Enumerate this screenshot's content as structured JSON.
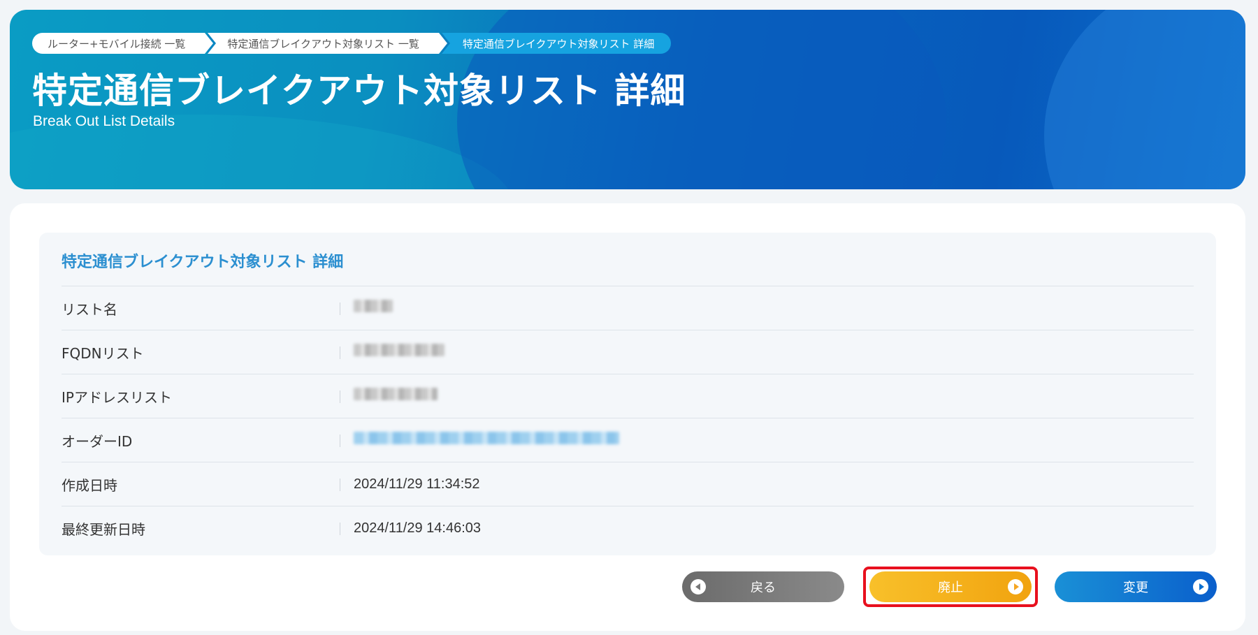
{
  "breadcrumb": {
    "items": [
      "ルーター+モバイル接続 一覧",
      "特定通信ブレイクアウト対象リスト 一覧",
      "特定通信ブレイクアウト対象リスト 詳細"
    ]
  },
  "header": {
    "title": "特定通信ブレイクアウト対象リスト 詳細",
    "subtitle": "Break Out List Details"
  },
  "detail": {
    "title": "特定通信ブレイクアウト対象リスト 詳細",
    "rows": [
      {
        "label": "リスト名",
        "value": "",
        "redacted": true
      },
      {
        "label": "FQDNリスト",
        "value": "",
        "redacted": true
      },
      {
        "label": "IPアドレスリスト",
        "value": "",
        "redacted": true
      },
      {
        "label": "オーダーID",
        "value": "",
        "redacted": true
      },
      {
        "label": "作成日時",
        "value": "2024/11/29 11:34:52"
      },
      {
        "label": "最終更新日時",
        "value": "2024/11/29 14:46:03"
      }
    ]
  },
  "buttons": {
    "back": "戻る",
    "abolish": "廃止",
    "change": "変更"
  },
  "colors": {
    "accent": "#2b8fd0",
    "abolish_button": "#f5a623",
    "change_button": "#0a6fd0",
    "highlight": "#e8101e"
  }
}
